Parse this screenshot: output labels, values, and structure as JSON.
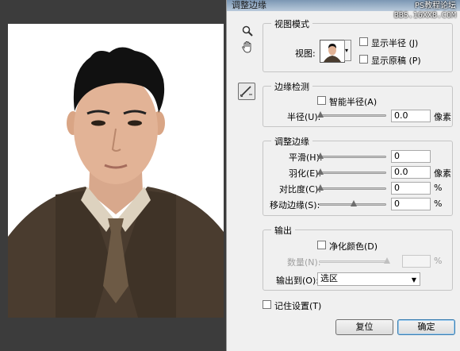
{
  "dialog": {
    "title": "调整边缘",
    "watermark_line1": "PS教程论坛",
    "watermark_line2": "BBS.16XX8.COM"
  },
  "tools": {
    "zoom_icon": "magnifier",
    "hand_icon": "hand",
    "refine_radius_icon": "brush"
  },
  "view_mode": {
    "legend": "视图模式",
    "view_label": "视图:",
    "show_radius": "显示半径 (J)",
    "show_original": "显示原稿 (P)"
  },
  "edge_detection": {
    "legend": "边缘检测",
    "smart_radius": "智能半径(A)",
    "radius_label": "半径(U):",
    "radius_value": "0.0",
    "radius_unit": "像素"
  },
  "adjust_edge": {
    "legend": "调整边缘",
    "smooth_label": "平滑(H):",
    "smooth_value": "0",
    "feather_label": "羽化(E):",
    "feather_value": "0.0",
    "feather_unit": "像素",
    "contrast_label": "对比度(C):",
    "contrast_value": "0",
    "contrast_unit": "%",
    "shift_label": "移动边缘(S):",
    "shift_value": "0",
    "shift_unit": "%"
  },
  "output": {
    "legend": "输出",
    "decontaminate": "净化颜色(D)",
    "amount_label": "数量(N):",
    "amount_unit": "%",
    "output_to_label": "输出到(O):",
    "output_to_value": "选区"
  },
  "remember_settings": "记住设置(T)",
  "buttons": {
    "reset": "复位",
    "ok": "确定"
  }
}
